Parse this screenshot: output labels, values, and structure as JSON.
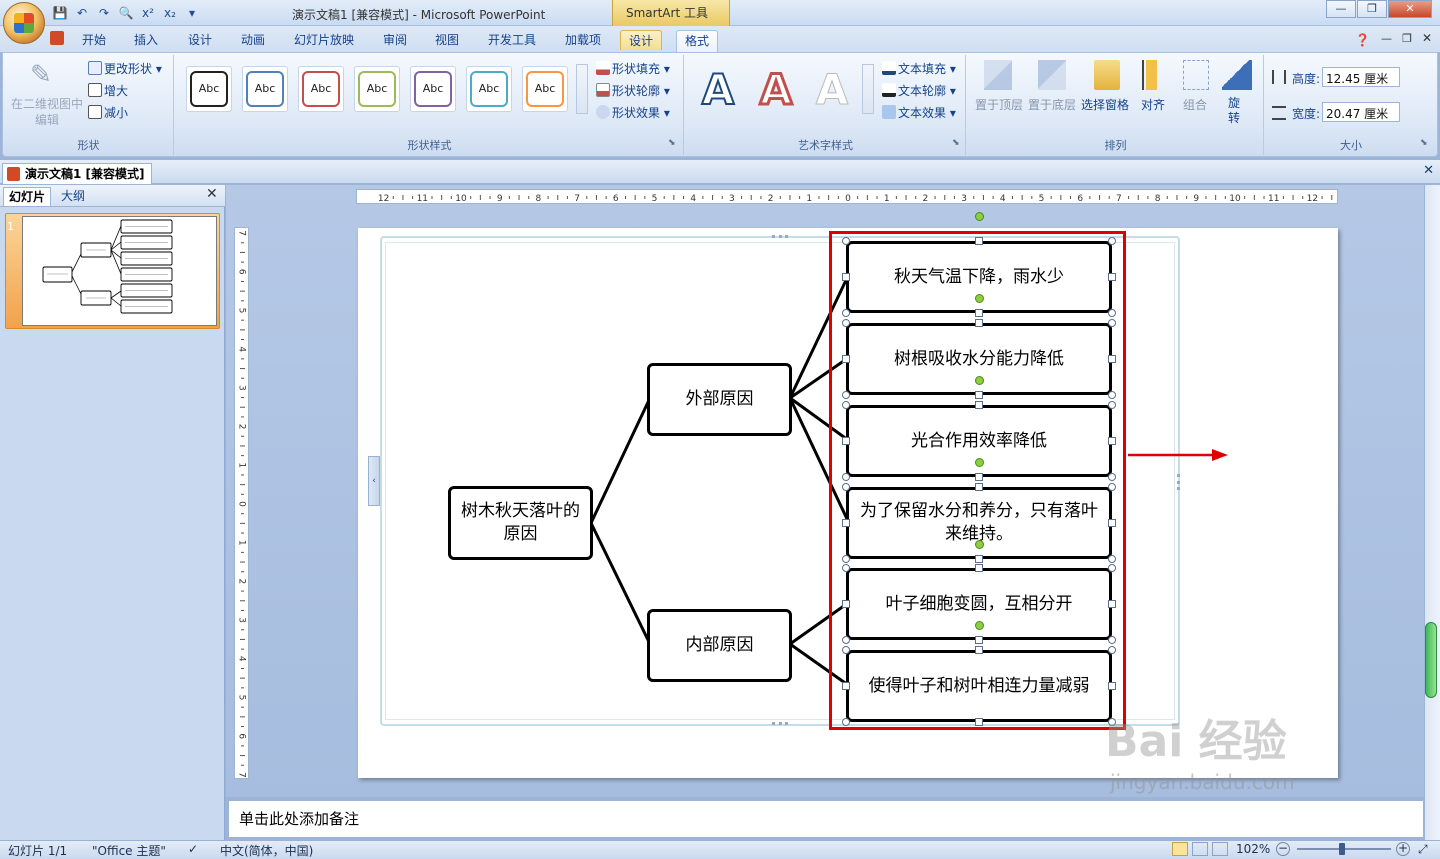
{
  "window": {
    "title": "演示文稿1 [兼容模式] - Microsoft PowerPoint",
    "context_tool": "SmartArt 工具",
    "controls": [
      "—",
      "❐",
      "✕"
    ]
  },
  "tabs": [
    "开始",
    "插入",
    "设计",
    "动画",
    "幻灯片放映",
    "审阅",
    "视图",
    "开发工具",
    "加载项",
    "设计",
    "格式"
  ],
  "active_tab": "格式",
  "ribbon": {
    "shapes_group": {
      "edit2d": "在二维视图中编辑",
      "change_shape": "更改形状",
      "larger": "增大",
      "smaller": "减小",
      "label": "形状"
    },
    "shape_styles": {
      "sample": "Abc",
      "fill": "形状填充",
      "outline": "形状轮廓",
      "effects": "形状效果",
      "label": "形状样式",
      "colors": [
        "#222222",
        "#4f81bd",
        "#c0504d",
        "#9bbb59",
        "#8064a2",
        "#4bacc6",
        "#f79646"
      ]
    },
    "wordart": {
      "letter": "A",
      "fill": "文本填充",
      "outline": "文本轮廓",
      "effects": "文本效果",
      "label": "艺术字样式"
    },
    "arrange": {
      "front": "置于顶层",
      "back": "置于底层",
      "pane": "选择窗格",
      "align": "对齐",
      "group": "组合",
      "rotate": "旋转",
      "label": "排列"
    },
    "size": {
      "height_label": "高度:",
      "height": "12.45 厘米",
      "width_label": "宽度:",
      "width": "20.47 厘米",
      "label": "大小"
    }
  },
  "document_tab": "演示文稿1 [兼容模式]",
  "left_pane": {
    "tabs": [
      "幻灯片",
      "大纲"
    ],
    "slide_number": "1"
  },
  "ruler": {
    "horizontal": [
      "12",
      "11",
      "10",
      "9",
      "8",
      "7",
      "6",
      "5",
      "4",
      "3",
      "2",
      "1",
      "0",
      "1",
      "2",
      "3",
      "4",
      "5",
      "6",
      "7",
      "8",
      "9",
      "10",
      "11",
      "12"
    ],
    "vertical": [
      "7",
      "6",
      "5",
      "4",
      "3",
      "2",
      "1",
      "0",
      "1",
      "2",
      "3",
      "4",
      "5",
      "6",
      "7"
    ]
  },
  "diagram": {
    "root": "树木秋天落叶的原因",
    "branches": [
      {
        "label": "外部原因",
        "leaves": [
          "秋天气温下降，雨水少",
          "树根吸收水分能力降低",
          "光合作用效率降低",
          "为了保留水分和养分，只有落叶来维持。"
        ]
      },
      {
        "label": "内部原因",
        "leaves": [
          "叶子细胞变圆，互相分开",
          "使得叶子和树叶相连力量减弱"
        ]
      }
    ],
    "highlight_color": "#e00000"
  },
  "notes_placeholder": "单击此处添加备注",
  "status": {
    "slide": "幻灯片 1/1",
    "theme": "\"Office 主题\"",
    "language": "中文(简体，中国)",
    "zoom": "102%"
  },
  "watermark": {
    "brand": "Bai 经验",
    "url": "jingyan.baidu.com"
  }
}
